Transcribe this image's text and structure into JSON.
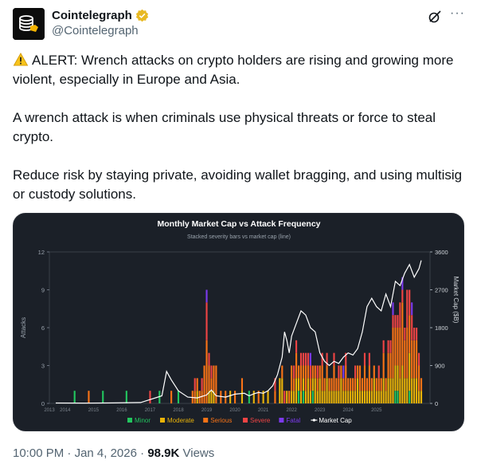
{
  "tweet": {
    "author_name": "Cointelegraph",
    "author_handle": "@Cointelegraph",
    "paragraphs": [
      "ALERT: Wrench attacks on crypto holders are rising and growing more violent, especially in Europe and Asia.",
      "A wrench attack is when criminals use physical threats or force to steal crypto.",
      "Reduce risk by staying private, avoiding wallet bragging, and using multisig or custody solutions."
    ],
    "time": "10:00 PM",
    "date": "Jan 4, 2026",
    "separator": "·",
    "views_count": "98.9K",
    "views_label": "Views",
    "more_label": "···",
    "icons": [
      "verified-badge-icon",
      "grok-icon",
      "more-icon",
      "warning-icon"
    ]
  },
  "chart_data": {
    "type": "bar",
    "title": "Monthly Market Cap vs Attack Frequency",
    "subtitle": "Stacked severity bars vs market cap (line)",
    "ylabel": "Attacks",
    "y2label": "Market Cap ($B)",
    "ylim": [
      0,
      12
    ],
    "y2lim": [
      0,
      3600
    ],
    "yticks": [
      "0",
      "3",
      "6",
      "9",
      "12"
    ],
    "y2ticks": [
      "0",
      "900",
      "1800",
      "2700",
      "3600"
    ],
    "xticks": [
      "2014",
      "2015",
      "2016",
      "2017",
      "2018",
      "2019",
      "2020",
      "2021",
      "2022",
      "2023",
      "2024",
      "2025"
    ],
    "x_first_label": "2013",
    "legend": [
      {
        "name": "Minor",
        "color": "#22c55e"
      },
      {
        "name": "Moderate",
        "color": "#eab308"
      },
      {
        "name": "Serious",
        "color": "#f97316"
      },
      {
        "name": "Severe",
        "color": "#ef4444"
      },
      {
        "name": "Fatal",
        "color": "#7c3aed"
      },
      {
        "name": "Market Cap",
        "color": "#ffffff"
      }
    ],
    "start_year": 2014,
    "bars": [
      {
        "m": 8,
        "v": [
          1,
          0,
          0,
          0,
          0
        ]
      },
      {
        "m": 14,
        "v": [
          0,
          0,
          1,
          0,
          0
        ]
      },
      {
        "m": 20,
        "v": [
          1,
          0,
          0,
          0,
          0
        ]
      },
      {
        "m": 30,
        "v": [
          1,
          0,
          0,
          0,
          0
        ]
      },
      {
        "m": 40,
        "v": [
          0,
          0,
          0,
          1,
          0
        ]
      },
      {
        "m": 44,
        "v": [
          1,
          0,
          0,
          0,
          0
        ]
      },
      {
        "m": 49,
        "v": [
          0,
          0,
          1,
          0,
          0
        ]
      },
      {
        "m": 52,
        "v": [
          1,
          0,
          0,
          0,
          0
        ]
      },
      {
        "m": 58,
        "v": [
          0,
          0,
          1,
          0,
          0
        ]
      },
      {
        "m": 59,
        "v": [
          0,
          0,
          1,
          1,
          0
        ]
      },
      {
        "m": 60,
        "v": [
          0,
          1,
          1,
          0,
          0
        ]
      },
      {
        "m": 61,
        "v": [
          0,
          0,
          1,
          0,
          0
        ]
      },
      {
        "m": 62,
        "v": [
          0,
          0,
          1,
          1,
          0
        ]
      },
      {
        "m": 63,
        "v": [
          0,
          0,
          3,
          0,
          0
        ]
      },
      {
        "m": 64,
        "v": [
          0,
          0,
          5,
          3,
          1
        ]
      },
      {
        "m": 65,
        "v": [
          0,
          1,
          2,
          1,
          0
        ]
      },
      {
        "m": 66,
        "v": [
          0,
          1,
          1,
          1,
          0
        ]
      },
      {
        "m": 67,
        "v": [
          0,
          1,
          2,
          0,
          0
        ]
      },
      {
        "m": 68,
        "v": [
          0,
          0,
          3,
          0,
          0
        ]
      },
      {
        "m": 70,
        "v": [
          0,
          0,
          1,
          0,
          0
        ]
      },
      {
        "m": 72,
        "v": [
          0,
          0,
          1,
          0,
          0
        ]
      },
      {
        "m": 74,
        "v": [
          0,
          1,
          0,
          0,
          0
        ]
      },
      {
        "m": 76,
        "v": [
          0,
          0,
          1,
          0,
          0
        ]
      },
      {
        "m": 79,
        "v": [
          0,
          1,
          1,
          0,
          0
        ]
      },
      {
        "m": 82,
        "v": [
          1,
          0,
          0,
          0,
          0
        ]
      },
      {
        "m": 84,
        "v": [
          0,
          1,
          0,
          0,
          0
        ]
      },
      {
        "m": 86,
        "v": [
          0,
          0,
          1,
          0,
          0
        ]
      },
      {
        "m": 88,
        "v": [
          0,
          1,
          0,
          0,
          0
        ]
      },
      {
        "m": 90,
        "v": [
          0,
          1,
          0,
          0,
          0
        ]
      },
      {
        "m": 93,
        "v": [
          0,
          0,
          1,
          1,
          0
        ]
      },
      {
        "m": 95,
        "v": [
          0,
          2,
          0,
          0,
          0
        ]
      },
      {
        "m": 96,
        "v": [
          0,
          2,
          1,
          0,
          0
        ]
      },
      {
        "m": 97,
        "v": [
          0,
          0,
          0,
          1,
          0
        ]
      },
      {
        "m": 98,
        "v": [
          0,
          1,
          0,
          0,
          0
        ]
      },
      {
        "m": 99,
        "v": [
          0,
          0,
          1,
          0,
          0
        ]
      },
      {
        "m": 100,
        "v": [
          0,
          1,
          2,
          0,
          0
        ]
      },
      {
        "m": 101,
        "v": [
          0,
          1,
          1,
          1,
          0
        ]
      },
      {
        "m": 102,
        "v": [
          0,
          2,
          2,
          1,
          0
        ]
      },
      {
        "m": 103,
        "v": [
          1,
          1,
          1,
          0,
          0
        ]
      },
      {
        "m": 104,
        "v": [
          0,
          1,
          2,
          1,
          0
        ]
      },
      {
        "m": 105,
        "v": [
          1,
          1,
          1,
          1,
          0
        ]
      },
      {
        "m": 106,
        "v": [
          0,
          1,
          2,
          1,
          0
        ]
      },
      {
        "m": 107,
        "v": [
          0,
          2,
          1,
          1,
          0
        ]
      },
      {
        "m": 108,
        "v": [
          0,
          1,
          1,
          1,
          1
        ]
      },
      {
        "m": 109,
        "v": [
          1,
          1,
          1,
          0,
          0
        ]
      },
      {
        "m": 110,
        "v": [
          0,
          2,
          1,
          0,
          0
        ]
      },
      {
        "m": 111,
        "v": [
          0,
          1,
          1,
          1,
          0
        ]
      },
      {
        "m": 112,
        "v": [
          0,
          2,
          1,
          0,
          0
        ]
      },
      {
        "m": 113,
        "v": [
          0,
          1,
          2,
          1,
          0
        ]
      },
      {
        "m": 114,
        "v": [
          0,
          1,
          1,
          0,
          0
        ]
      },
      {
        "m": 115,
        "v": [
          0,
          2,
          1,
          1,
          0
        ]
      },
      {
        "m": 116,
        "v": [
          0,
          1,
          1,
          0,
          0
        ]
      },
      {
        "m": 117,
        "v": [
          0,
          1,
          1,
          0,
          0
        ]
      },
      {
        "m": 118,
        "v": [
          0,
          1,
          2,
          1,
          0
        ]
      },
      {
        "m": 119,
        "v": [
          0,
          1,
          1,
          0,
          0
        ]
      },
      {
        "m": 120,
        "v": [
          0,
          1,
          1,
          1,
          0
        ]
      },
      {
        "m": 121,
        "v": [
          0,
          2,
          1,
          0,
          0
        ]
      },
      {
        "m": 122,
        "v": [
          0,
          1,
          1,
          0,
          1
        ]
      },
      {
        "m": 123,
        "v": [
          0,
          1,
          2,
          1,
          0
        ]
      },
      {
        "m": 124,
        "v": [
          0,
          1,
          1,
          0,
          0
        ]
      },
      {
        "m": 125,
        "v": [
          0,
          1,
          1,
          0,
          0
        ]
      },
      {
        "m": 126,
        "v": [
          0,
          1,
          1,
          0,
          0
        ]
      },
      {
        "m": 127,
        "v": [
          0,
          1,
          1,
          1,
          0
        ]
      },
      {
        "m": 128,
        "v": [
          0,
          2,
          1,
          0,
          0
        ]
      },
      {
        "m": 129,
        "v": [
          0,
          1,
          2,
          0,
          0
        ]
      },
      {
        "m": 130,
        "v": [
          0,
          1,
          1,
          0,
          0
        ]
      },
      {
        "m": 131,
        "v": [
          0,
          1,
          2,
          1,
          0
        ]
      },
      {
        "m": 132,
        "v": [
          0,
          1,
          1,
          0,
          0
        ]
      },
      {
        "m": 133,
        "v": [
          0,
          1,
          2,
          1,
          0
        ]
      },
      {
        "m": 134,
        "v": [
          0,
          1,
          1,
          0,
          0
        ]
      },
      {
        "m": 135,
        "v": [
          0,
          2,
          1,
          0,
          0
        ]
      },
      {
        "m": 136,
        "v": [
          0,
          1,
          1,
          0,
          0
        ]
      },
      {
        "m": 137,
        "v": [
          0,
          1,
          1,
          1,
          0
        ]
      },
      {
        "m": 138,
        "v": [
          0,
          1,
          1,
          0,
          0
        ]
      },
      {
        "m": 139,
        "v": [
          0,
          2,
          2,
          1,
          0
        ]
      },
      {
        "m": 140,
        "v": [
          0,
          1,
          1,
          0,
          0
        ]
      },
      {
        "m": 141,
        "v": [
          0,
          2,
          2,
          1,
          0
        ]
      },
      {
        "m": 142,
        "v": [
          0,
          2,
          2,
          1,
          0
        ]
      },
      {
        "m": 143,
        "v": [
          0,
          2,
          4,
          1,
          1
        ]
      },
      {
        "m": 144,
        "v": [
          1,
          2,
          3,
          1,
          0
        ]
      },
      {
        "m": 145,
        "v": [
          1,
          2,
          3,
          1,
          0
        ]
      },
      {
        "m": 146,
        "v": [
          0,
          2,
          4,
          2,
          0
        ]
      },
      {
        "m": 147,
        "v": [
          0,
          3,
          5,
          1,
          1
        ]
      },
      {
        "m": 148,
        "v": [
          0,
          2,
          3,
          1,
          0
        ]
      },
      {
        "m": 149,
        "v": [
          0,
          2,
          4,
          3,
          0
        ]
      },
      {
        "m": 150,
        "v": [
          1,
          3,
          3,
          2,
          0
        ]
      },
      {
        "m": 151,
        "v": [
          0,
          2,
          3,
          2,
          1
        ]
      },
      {
        "m": 152,
        "v": [
          0,
          2,
          3,
          1,
          0
        ]
      },
      {
        "m": 153,
        "v": [
          0,
          2,
          3,
          1,
          0
        ]
      },
      {
        "m": 154,
        "v": [
          0,
          1,
          2,
          1,
          0
        ]
      },
      {
        "m": 155,
        "v": [
          0,
          1,
          1,
          0,
          0
        ]
      }
    ],
    "market_cap": [
      [
        0,
        10
      ],
      [
        12,
        8
      ],
      [
        24,
        12
      ],
      [
        36,
        20
      ],
      [
        45,
        180
      ],
      [
        47,
        760
      ],
      [
        49,
        560
      ],
      [
        52,
        300
      ],
      [
        56,
        150
      ],
      [
        60,
        130
      ],
      [
        64,
        200
      ],
      [
        66,
        320
      ],
      [
        68,
        180
      ],
      [
        72,
        150
      ],
      [
        76,
        220
      ],
      [
        80,
        240
      ],
      [
        82,
        180
      ],
      [
        84,
        230
      ],
      [
        86,
        260
      ],
      [
        88,
        240
      ],
      [
        90,
        300
      ],
      [
        92,
        420
      ],
      [
        94,
        680
      ],
      [
        96,
        1100
      ],
      [
        97,
        1700
      ],
      [
        98,
        1500
      ],
      [
        99,
        1200
      ],
      [
        100,
        1600
      ],
      [
        102,
        1900
      ],
      [
        104,
        2200
      ],
      [
        106,
        2100
      ],
      [
        108,
        1800
      ],
      [
        110,
        1700
      ],
      [
        112,
        1200
      ],
      [
        114,
        1000
      ],
      [
        116,
        900
      ],
      [
        118,
        1000
      ],
      [
        120,
        950
      ],
      [
        122,
        1100
      ],
      [
        124,
        1200
      ],
      [
        126,
        1150
      ],
      [
        128,
        1300
      ],
      [
        130,
        1700
      ],
      [
        132,
        2300
      ],
      [
        134,
        2500
      ],
      [
        136,
        2300
      ],
      [
        138,
        2200
      ],
      [
        140,
        2600
      ],
      [
        142,
        2300
      ],
      [
        144,
        2900
      ],
      [
        146,
        2800
      ],
      [
        148,
        3100
      ],
      [
        150,
        3300
      ],
      [
        152,
        3000
      ],
      [
        154,
        3200
      ],
      [
        155,
        3400
      ]
    ]
  }
}
